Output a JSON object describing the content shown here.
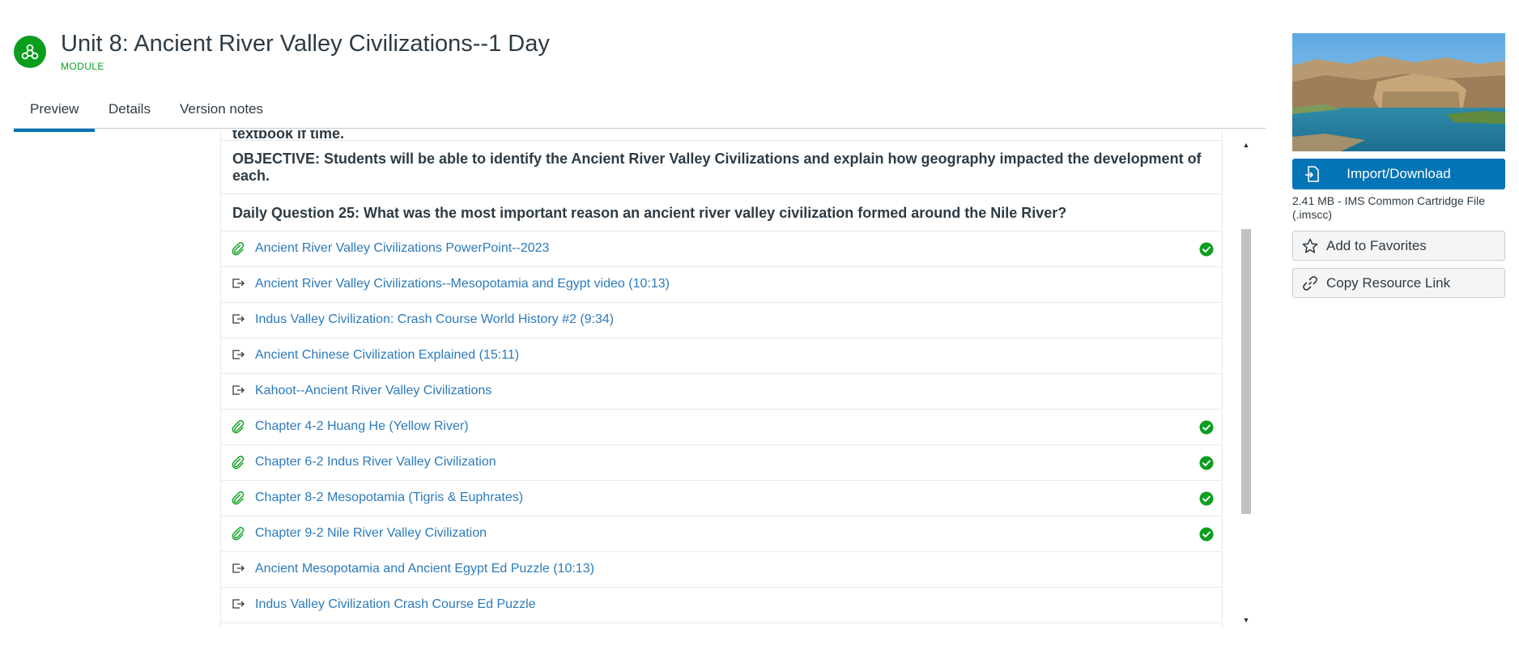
{
  "header": {
    "title": "Unit 8: Ancient River Valley Civilizations--1 Day",
    "type_label": "MODULE"
  },
  "tabs": [
    {
      "label": "Preview",
      "active": true
    },
    {
      "label": "Details",
      "active": false
    },
    {
      "label": "Version notes",
      "active": false
    }
  ],
  "content": {
    "partial_text": "textbook if time.",
    "objective_text": "OBJECTIVE: Students will be able to identify the Ancient River Valley Civilizations and explain how geography impacted the development of each.",
    "daily_question": "Daily Question 25: What was the most important reason an ancient river valley civilization formed around the Nile River?",
    "items": [
      {
        "type": "attachment",
        "label": "Ancient River Valley Civilizations PowerPoint--2023",
        "published": true
      },
      {
        "type": "external",
        "label": "Ancient River Valley Civilizations--Mesopotamia and Egypt video (10:13)",
        "published": false
      },
      {
        "type": "external",
        "label": "Indus Valley Civilization: Crash Course World History #2 (9:34)",
        "published": false
      },
      {
        "type": "external",
        "label": "Ancient Chinese Civilization Explained (15:11)",
        "published": false
      },
      {
        "type": "external",
        "label": "Kahoot--Ancient River Valley Civilizations",
        "published": false
      },
      {
        "type": "attachment",
        "label": "Chapter 4-2 Huang He (Yellow River)",
        "published": true
      },
      {
        "type": "attachment",
        "label": "Chapter 6-2 Indus River Valley Civilization",
        "published": true
      },
      {
        "type": "attachment",
        "label": "Chapter 8-2 Mesopotamia (Tigris & Euphrates)",
        "published": true
      },
      {
        "type": "attachment",
        "label": "Chapter 9-2 Nile River Valley Civilization",
        "published": true
      },
      {
        "type": "external",
        "label": "Ancient Mesopotamia and Ancient Egypt Ed Puzzle (10:13)",
        "published": false
      },
      {
        "type": "external",
        "label": "Indus Valley Civilization Crash Course Ed Puzzle",
        "published": false
      }
    ]
  },
  "sidebar": {
    "import_label": "Import/Download",
    "file_info": "2.41 MB - IMS Common Cartridge File (.imscc)",
    "favorites_label": "Add to Favorites",
    "copy_link_label": "Copy Resource Link"
  },
  "colors": {
    "accent": "#0374b5",
    "module_green": "#0b9e1e",
    "link": "#2b7abc",
    "text": "#2d3b45"
  },
  "icons": {
    "module": "module-icon",
    "attachment": "paperclip-icon",
    "external": "external-link-icon",
    "published": "check-circle-icon",
    "import": "import-icon",
    "favorites": "star-icon",
    "copy_link": "link-icon"
  }
}
